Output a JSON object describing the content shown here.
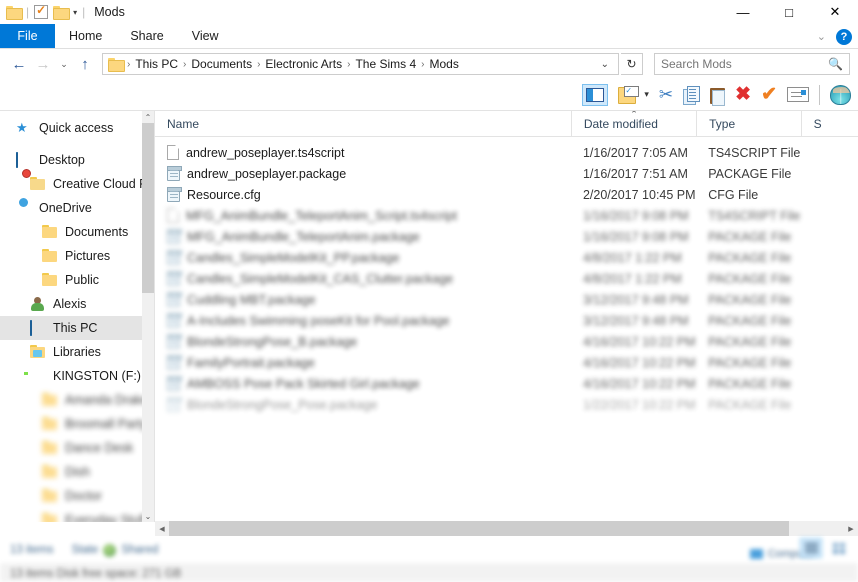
{
  "window": {
    "title": "Mods",
    "quick_access_icons": [
      "folder-icon",
      "properties-icon",
      "new-folder-icon"
    ],
    "controls": {
      "minimize": "—",
      "maximize": "□",
      "close": "✕"
    }
  },
  "ribbon": {
    "tabs": [
      {
        "label": "File",
        "active_blue": true
      },
      {
        "label": "Home",
        "active_blue": false
      },
      {
        "label": "Share",
        "active_blue": false
      },
      {
        "label": "View",
        "active_blue": false
      }
    ],
    "collapse_caret": "⌄",
    "help_label": "?"
  },
  "address": {
    "back": "←",
    "forward": "→",
    "recent": "⌄",
    "up": "↑",
    "breadcrumbs": [
      "This PC",
      "Documents",
      "Electronic Arts",
      "The Sims 4",
      "Mods"
    ],
    "separator": "›",
    "dropdown_caret": "⌄",
    "refresh": "↻"
  },
  "search": {
    "placeholder": "Search Mods",
    "value": "",
    "icon": "search-icon"
  },
  "toolbar": {
    "items": [
      {
        "name": "navigation-pane-toggle",
        "label": "Navigation pane",
        "active": true
      },
      {
        "name": "folder-properties",
        "label": "Properties"
      },
      {
        "name": "properties-dropdown",
        "label": "▾"
      },
      {
        "name": "cut",
        "label": "Cut"
      },
      {
        "name": "copy",
        "label": "Copy"
      },
      {
        "name": "paste",
        "label": "Paste"
      },
      {
        "name": "delete",
        "label": "Delete"
      },
      {
        "name": "select-all",
        "label": "Select"
      },
      {
        "name": "rename",
        "label": "Rename"
      },
      {
        "name": "shell-app",
        "label": "Shell"
      }
    ]
  },
  "navpane": {
    "items": [
      {
        "label": "Quick access",
        "icon": "star-icon",
        "indent": 1,
        "blurred": false,
        "selected": false
      },
      {
        "label": "Desktop",
        "icon": "monitor-icon",
        "indent": 1,
        "blurred": false,
        "selected": false
      },
      {
        "label": "Creative Cloud F",
        "icon": "creative-cloud-folder-icon",
        "indent": 2,
        "blurred": false,
        "selected": false
      },
      {
        "label": "OneDrive",
        "icon": "cloud-icon",
        "indent": 1,
        "blurred": false,
        "selected": false
      },
      {
        "label": "Documents",
        "icon": "folder-icon",
        "indent": 2,
        "blurred": false,
        "selected": false
      },
      {
        "label": "Pictures",
        "icon": "folder-icon",
        "indent": 2,
        "blurred": false,
        "selected": false
      },
      {
        "label": "Public",
        "icon": "folder-icon",
        "indent": 2,
        "blurred": false,
        "selected": false
      },
      {
        "label": "Alexis",
        "icon": "person-icon",
        "indent": 1,
        "blurred": false,
        "selected": false
      },
      {
        "label": "This PC",
        "icon": "monitor-icon",
        "indent": 1,
        "blurred": false,
        "selected": true
      },
      {
        "label": "Libraries",
        "icon": "library-icon",
        "indent": 1,
        "blurred": false,
        "selected": false
      },
      {
        "label": "KINGSTON (F:)",
        "icon": "usb-drive-icon",
        "indent": 1,
        "blurred": false,
        "selected": false
      },
      {
        "label": "Amanda Drake",
        "icon": "folder-icon",
        "indent": 2,
        "blurred": true,
        "selected": false
      },
      {
        "label": "Broomall Party",
        "icon": "folder-icon",
        "indent": 2,
        "blurred": true,
        "selected": false
      },
      {
        "label": "Dance Desk",
        "icon": "folder-icon",
        "indent": 2,
        "blurred": true,
        "selected": false
      },
      {
        "label": "Dish",
        "icon": "folder-icon",
        "indent": 2,
        "blurred": true,
        "selected": false
      },
      {
        "label": "Doctor",
        "icon": "folder-icon",
        "indent": 2,
        "blurred": true,
        "selected": false
      },
      {
        "label": "Everyday Stuff",
        "icon": "folder-icon",
        "indent": 2,
        "blurred": true,
        "selected": false
      }
    ],
    "scroll_up": "⌃",
    "scroll_down": "⌄"
  },
  "filelist": {
    "columns": [
      {
        "label": "Name",
        "sorted": false
      },
      {
        "label": "Date modified",
        "sorted": true,
        "sort_caret": "⌃"
      },
      {
        "label": "Type",
        "sorted": false
      },
      {
        "label": "S",
        "sorted": false
      }
    ],
    "rows": [
      {
        "name": "andrew_poseplayer.ts4script",
        "date": "1/16/2017 7:05 AM",
        "type": "TS4SCRIPT File",
        "size": "",
        "icon": "generic-file-icon",
        "blurred": false
      },
      {
        "name": "andrew_poseplayer.package",
        "date": "1/16/2017 7:51 AM",
        "type": "PACKAGE File",
        "size": "",
        "icon": "package-file-icon",
        "blurred": false
      },
      {
        "name": "Resource.cfg",
        "date": "2/20/2017 10:45 PM",
        "type": "CFG File",
        "size": "",
        "icon": "config-file-icon",
        "blurred": false
      },
      {
        "name": "MFG_AnimBundle_TeleportAnim_Script.ts4script",
        "date": "1/16/2017 9:08 PM",
        "type": "TS4SCRIPT File",
        "size": "",
        "icon": "generic-file-icon",
        "blurred": true
      },
      {
        "name": "MFG_AnimBundle_TeleportAnim.package",
        "date": "1/16/2017 9:08 PM",
        "type": "PACKAGE File",
        "size": "",
        "icon": "package-file-icon",
        "blurred": true
      },
      {
        "name": "Candles_SimpleModelKit_PP.package",
        "date": "4/8/2017 1:22 PM",
        "type": "PACKAGE File",
        "size": "",
        "icon": "package-file-icon",
        "blurred": true
      },
      {
        "name": "Candles_SimpleModelKit_CAS_Clutter.package",
        "date": "4/8/2017 1:22 PM",
        "type": "PACKAGE File",
        "size": "",
        "icon": "package-file-icon",
        "blurred": true
      },
      {
        "name": "Cuddling MBT.package",
        "date": "3/12/2017 9:48 PM",
        "type": "PACKAGE File",
        "size": "",
        "icon": "package-file-icon",
        "blurred": true
      },
      {
        "name": "A-Includes Swimming poseKit for Pool.package",
        "date": "3/12/2017 9:48 PM",
        "type": "PACKAGE File",
        "size": "",
        "icon": "package-file-icon",
        "blurred": true
      },
      {
        "name": "BlondeStrongPose_B.package",
        "date": "4/16/2017 10:22 PM",
        "type": "PACKAGE File",
        "size": "",
        "icon": "package-file-icon",
        "blurred": true
      },
      {
        "name": "FamilyPortrait.package",
        "date": "4/16/2017 10:22 PM",
        "type": "PACKAGE File",
        "size": "",
        "icon": "package-file-icon",
        "blurred": true
      },
      {
        "name": "AMBOSS Pose Pack Skirted Girl.package",
        "date": "4/16/2017 10:22 PM",
        "type": "PACKAGE File",
        "size": "",
        "icon": "package-file-icon",
        "blurred": true
      },
      {
        "name": "BlondeStrongPose_Pose.package",
        "date": "1/22/2017 10:22 PM",
        "type": "PACKAGE File",
        "size": "",
        "icon": "package-file-icon",
        "blurred": true
      }
    ]
  },
  "status": {
    "item_count": "13 items",
    "state_label": "State",
    "shared_label": "Shared",
    "bottom_text": "13 items  Disk free space: 271 GB",
    "computer_label": "Computer",
    "view_details": "details-view",
    "view_icons": "large-icons-view"
  }
}
